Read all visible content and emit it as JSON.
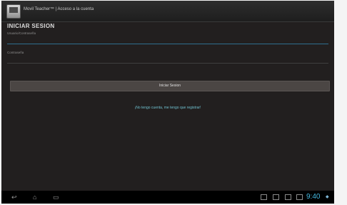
{
  "titlebar": {
    "title": "Movil Teacher™ | Acceso a la cuenta",
    "icon": "app-icon"
  },
  "form": {
    "heading": "INICIAR SESION",
    "username_label": "Usuario/Contraseña",
    "password_label": "Contraseña",
    "login_button": "Iniciar Sesion",
    "register_link": "¡No tengo cuenta, me tengo que registrar!"
  },
  "navbar": {
    "icons": [
      "back-icon",
      "home-icon",
      "recent-apps-icon"
    ],
    "status_icons": [
      "notification-icon",
      "gallery-icon",
      "download-icon",
      "sync-icon"
    ],
    "time": "9:40",
    "accent": "#44b8e0"
  }
}
